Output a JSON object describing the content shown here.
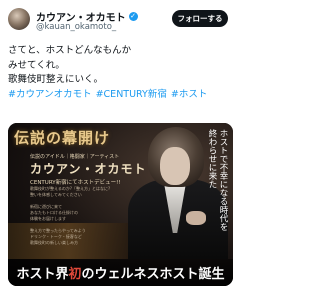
{
  "header": {
    "display_name": "カウアン・オカモト",
    "handle": "@kauan_okamoto_",
    "follow_label": "フォローする"
  },
  "post": {
    "lines": [
      "さてと、ホストどんなもんか",
      "みせてくれ。",
      "歌舞伎町整えにいく。"
    ],
    "hashtags": [
      "#カウアンオカモト",
      "#CENTURY新宿",
      "#ホスト"
    ]
  },
  "media": {
    "title": "伝説の幕開け",
    "role": "伝説のアイドル｜格闘家｜アーティスト",
    "name": "カウアン・オカモト",
    "subtitle": "CENTURY新宿にてホストデビュー!!",
    "details": [
      "歌舞伎町が整えるのか?「整え方」とはなに?",
      "整いを体感してみてください",
      "",
      "新宿に遊びに来て",
      "あなたもトロける仕掛けの",
      "体験をお届けします",
      "",
      "整え方で整ったらやってみよう",
      "ドリンク・トーク・接客など",
      "歌舞伎町の新しい楽しみ方"
    ],
    "vertical_text": [
      "ホストで不幸になる時代を",
      "終わらせに来た"
    ],
    "banner_pre": "ホスト界",
    "banner_highlight": "初",
    "banner_post": "のウェルネスホスト誕生"
  },
  "colors": {
    "accent": "#1d9bf0",
    "follow_bg": "#0f1419",
    "title_gold": "#e8c98c",
    "highlight_red": "#e0493a"
  }
}
